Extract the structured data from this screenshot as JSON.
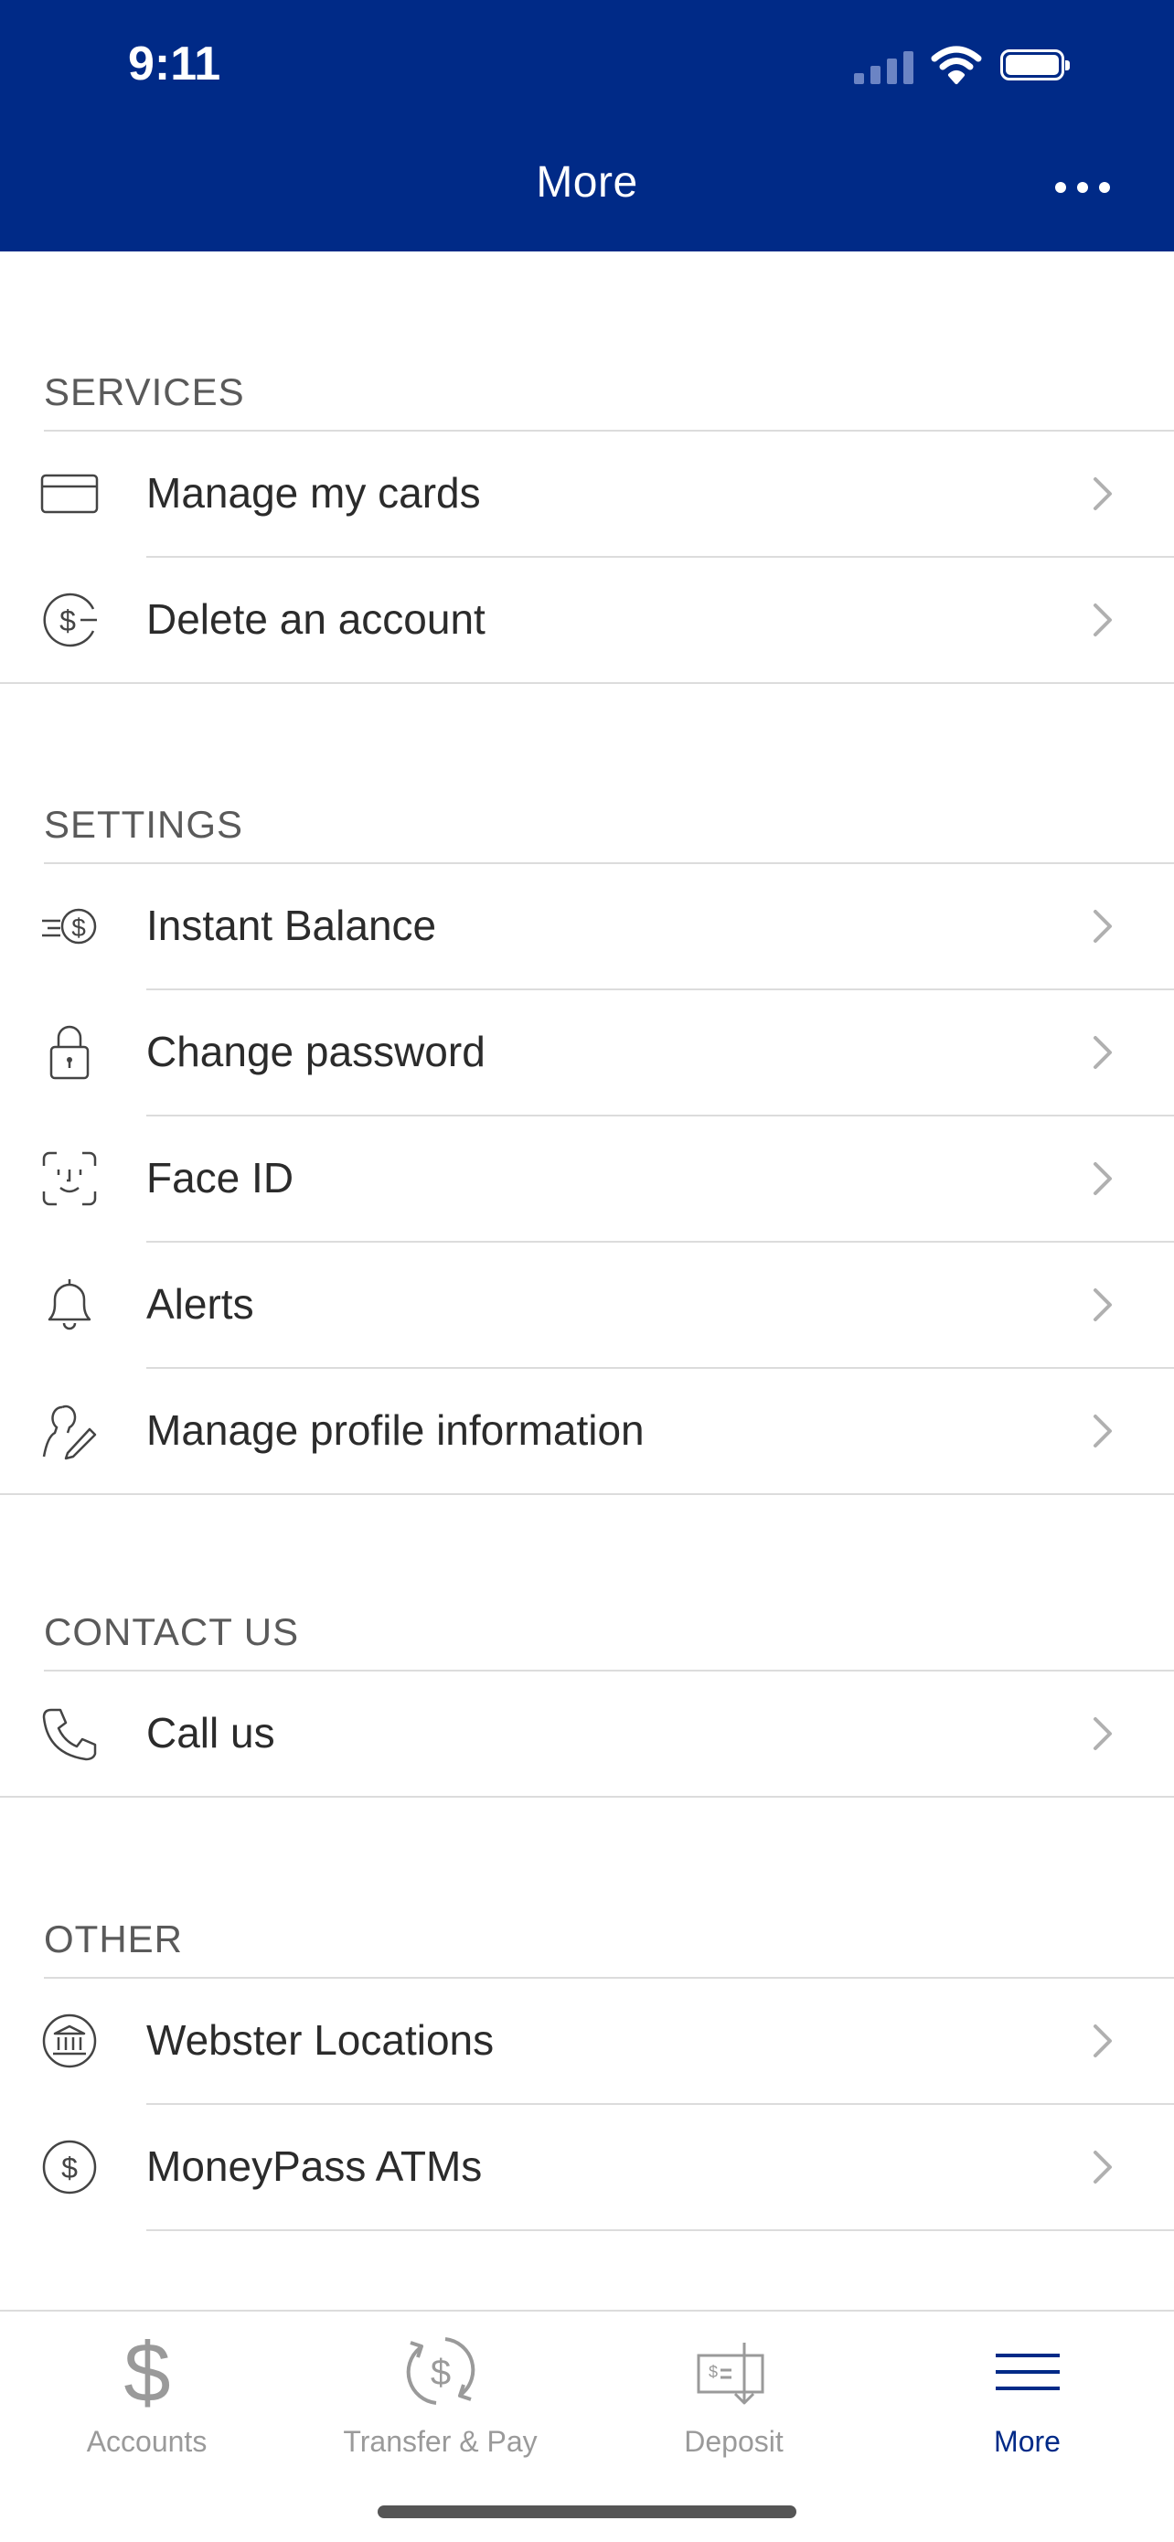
{
  "status_bar": {
    "time": "9:11"
  },
  "header": {
    "title": "More",
    "menu_icon": "ellipsis-icon"
  },
  "sections": {
    "services": {
      "title": "SERVICES",
      "items": [
        {
          "label": "Manage my cards",
          "icon": "credit-card-icon"
        },
        {
          "label": "Delete an account",
          "icon": "dollar-circle-icon"
        }
      ]
    },
    "settings": {
      "title": "SETTINGS",
      "items": [
        {
          "label": "Instant Balance",
          "icon": "instant-balance-icon"
        },
        {
          "label": "Change password",
          "icon": "lock-icon"
        },
        {
          "label": "Face ID",
          "icon": "face-id-icon"
        },
        {
          "label": "Alerts",
          "icon": "bell-icon"
        },
        {
          "label": "Manage profile information",
          "icon": "profile-edit-icon"
        }
      ]
    },
    "contact": {
      "title": "CONTACT US",
      "items": [
        {
          "label": "Call us",
          "icon": "phone-icon"
        }
      ]
    },
    "other": {
      "title": "OTHER",
      "items": [
        {
          "label": "Webster Locations",
          "icon": "bank-icon"
        },
        {
          "label": "MoneyPass ATMs",
          "icon": "dollar-circle-icon"
        }
      ]
    }
  },
  "tabbar": {
    "tabs": [
      {
        "label": "Accounts",
        "icon": "dollar-icon"
      },
      {
        "label": "Transfer & Pay",
        "icon": "transfer-icon"
      },
      {
        "label": "Deposit",
        "icon": "deposit-check-icon"
      },
      {
        "label": "More",
        "icon": "menu-lines-icon"
      }
    ],
    "active": "More"
  },
  "colors": {
    "brand": "#002a87",
    "inactive": "#9a9a9a",
    "divider": "#dcdcdc"
  }
}
